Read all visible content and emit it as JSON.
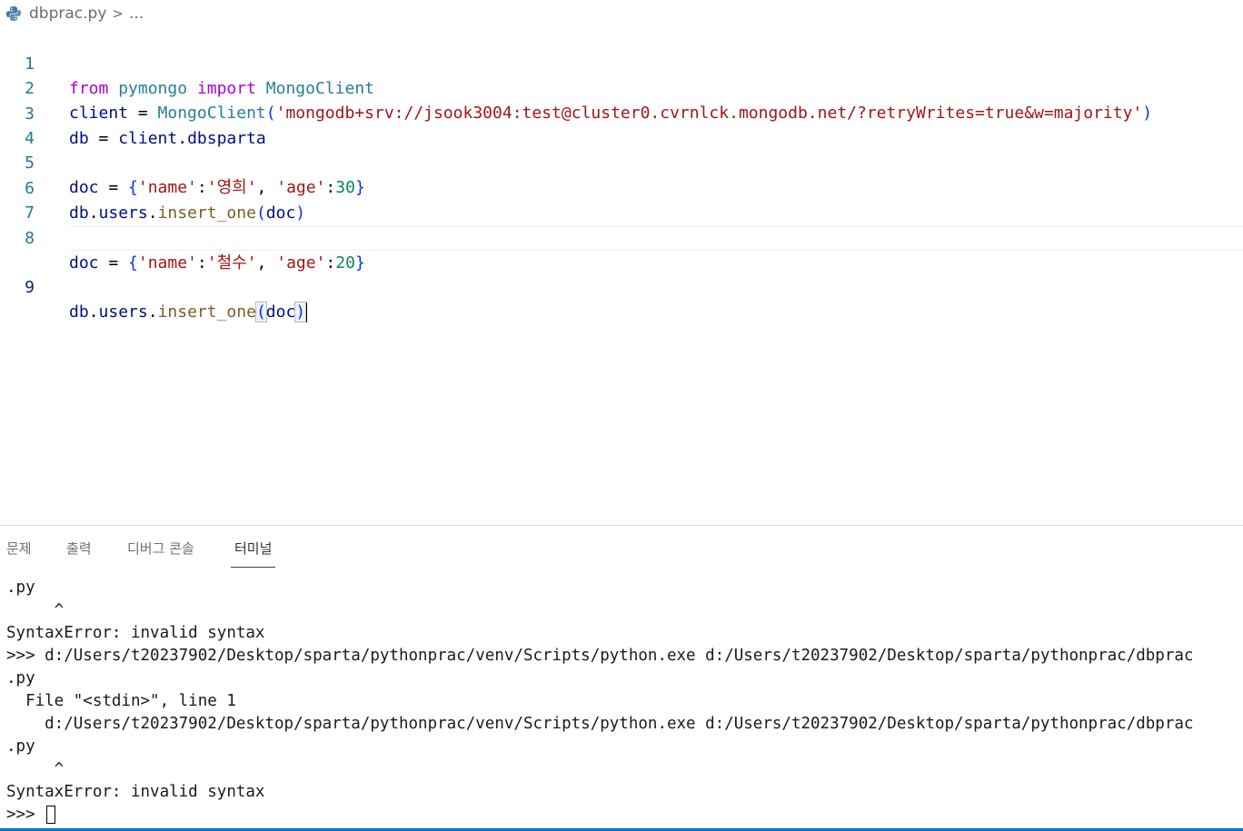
{
  "breadcrumb": {
    "icon": "python-file-icon",
    "filename": "dbprac.py",
    "separator": ">",
    "more": "..."
  },
  "editor": {
    "current_line": 9,
    "lines": [
      {
        "num": "1"
      },
      {
        "num": "2"
      },
      {
        "num": "3"
      },
      {
        "num": "4"
      },
      {
        "num": "5"
      },
      {
        "num": "6"
      },
      {
        "num": "7"
      },
      {
        "num": "8"
      },
      {
        "num": "9"
      }
    ],
    "tokens": {
      "from": "from",
      "pymongo": "pymongo",
      "import": "import",
      "MongoClient": "MongoClient",
      "client": "client",
      "eq": " = ",
      "uri": "'mongodb+srv://jsook3004:test@cluster0.cvrnlck.mongodb.net/?retryWrites=true&w=majority'",
      "db": "db",
      "dot": ".",
      "dbsparta": "dbsparta",
      "doc": "doc",
      "lbrace": "{",
      "rbrace": "}",
      "key_name": "'name'",
      "colon": ":",
      "comma": ", ",
      "key_age": "'age'",
      "val_1": "'영희'",
      "age_1": "30",
      "val_2": "'철수'",
      "age_2": "20",
      "users": "users",
      "insert_one": "insert_one",
      "lparen": "(",
      "rparen": ")"
    }
  },
  "panel": {
    "tabs": [
      "문제",
      "출력",
      "디버그 콘솔",
      "터미널"
    ],
    "active_tab": "터미널",
    "terminal_lines": [
      ".py",
      "     ^",
      "SyntaxError: invalid syntax",
      ">>> d:/Users/t20237902/Desktop/sparta/pythonprac/venv/Scripts/python.exe d:/Users/t20237902/Desktop/sparta/pythonprac/dbprac",
      ".py",
      "  File \"<stdin>\", line 1",
      "    d:/Users/t20237902/Desktop/sparta/pythonprac/venv/Scripts/python.exe d:/Users/t20237902/Desktop/sparta/pythonprac/dbprac",
      ".py",
      "     ^",
      "SyntaxError: invalid syntax",
      ">>> "
    ]
  },
  "colors": {
    "keyword": "#af00db",
    "class": "#267f99",
    "string": "#a31515",
    "number": "#098658",
    "function": "#795e26",
    "variable": "#001080",
    "line_number": "#237893",
    "status_bar": "#007acc"
  }
}
